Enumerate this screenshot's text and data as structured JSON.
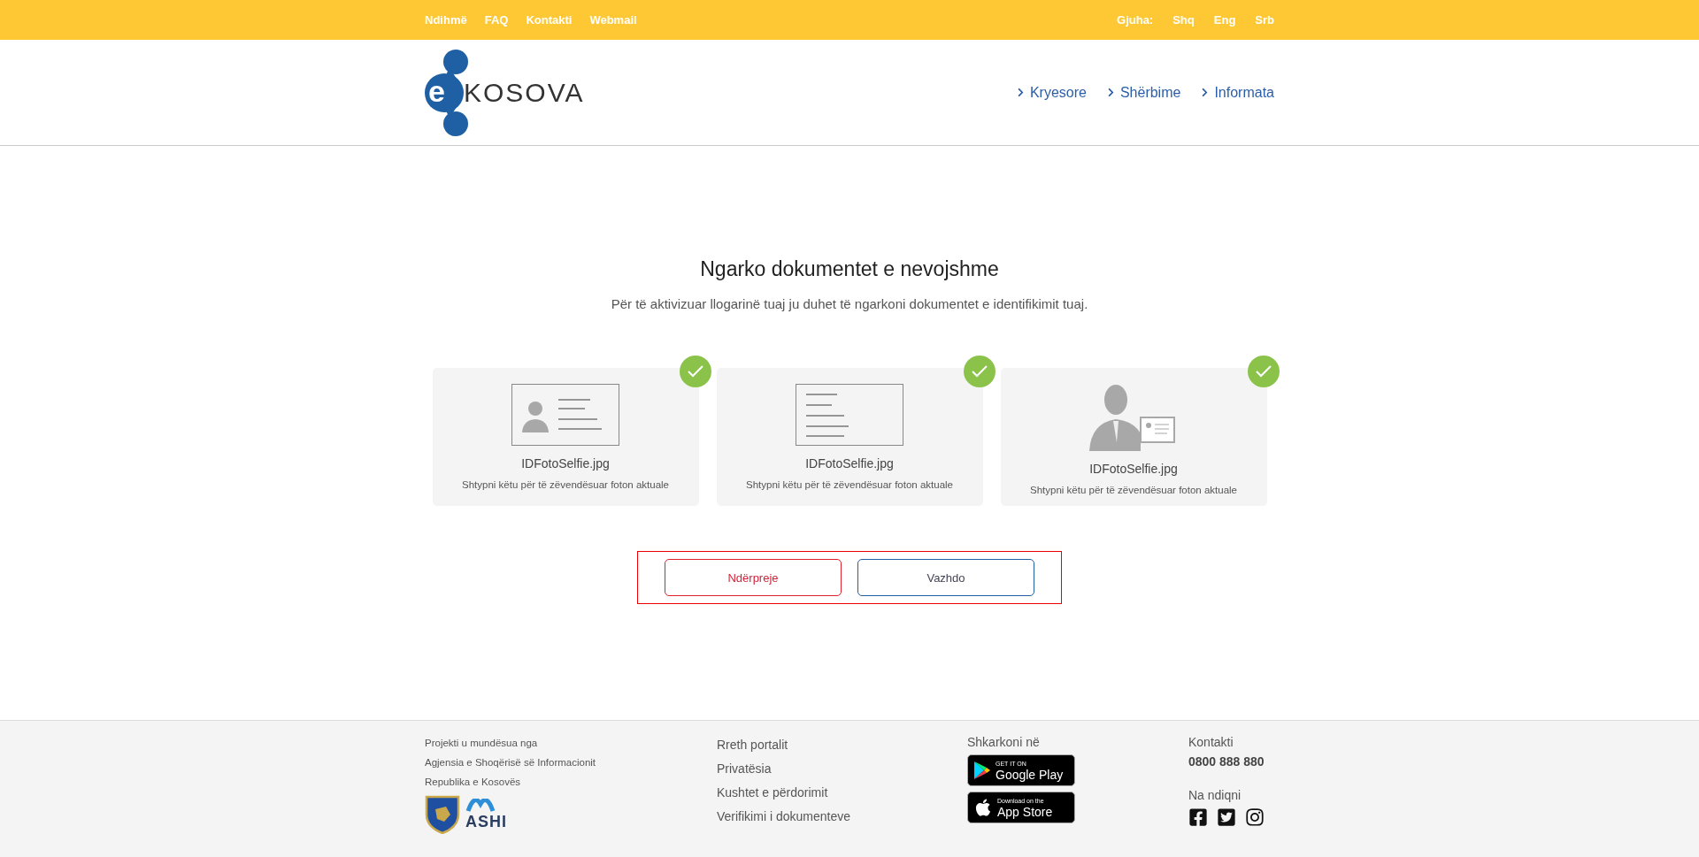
{
  "top_bar": {
    "links": [
      "Ndihmë",
      "FAQ",
      "Kontakti",
      "Webmail"
    ],
    "language_label": "Gjuha:",
    "languages": [
      {
        "label": "Shq",
        "selected": false
      },
      {
        "label": "Eng",
        "selected": false
      },
      {
        "label": "Srb",
        "selected": false
      }
    ]
  },
  "header": {
    "logo": {
      "letter": "e",
      "word": "KOSOVA"
    },
    "nav": [
      "Kryesore",
      "Shërbime",
      "Informata"
    ]
  },
  "main": {
    "title": "Ngarko dokumentet e nevojshme",
    "subtitle": "Për të aktivizuar llogarinë tuaj ju duhet të ngarkoni dokumentet e identifikimit tuaj.",
    "documents": [
      {
        "kind": "id-front",
        "file": "IDFotoSelfie.jpg",
        "hint": "Shtypni këtu për të zëvendësuar foton aktuale",
        "uploaded": true
      },
      {
        "kind": "id-back",
        "file": "IDFotoSelfie.jpg",
        "hint": "Shtypni këtu për të zëvendësuar foton aktuale",
        "uploaded": true
      },
      {
        "kind": "selfie",
        "file": "IDFotoSelfie.jpg",
        "hint": "Shtypni këtu për të zëvendësuar foton aktuale",
        "uploaded": true
      }
    ],
    "buttons": [
      {
        "kind": "cancel",
        "label": "Ndërpreje"
      },
      {
        "kind": "continue",
        "label": "Vazhdo"
      }
    ]
  },
  "footer": {
    "credits": [
      "Projekti u mundësua nga",
      "Agjensia e Shoqërisë së Informacionit",
      "Republika e Kosovës"
    ],
    "ashi_logo": "ASHI",
    "links": [
      "Rreth portalit",
      "Privatësia",
      "Kushtet e përdorimit",
      "Verifikimi i dokumenteve"
    ],
    "download": {
      "title": "Shkarkoni në",
      "stores": [
        {
          "kind": "google",
          "small": "GET IT ON",
          "big": "Google Play"
        },
        {
          "kind": "apple",
          "small": "Download on the",
          "big": "App Store"
        }
      ]
    },
    "contact": {
      "title": "Kontakti",
      "phone": "0800 888 880",
      "follow": "Na ndiqni"
    }
  }
}
